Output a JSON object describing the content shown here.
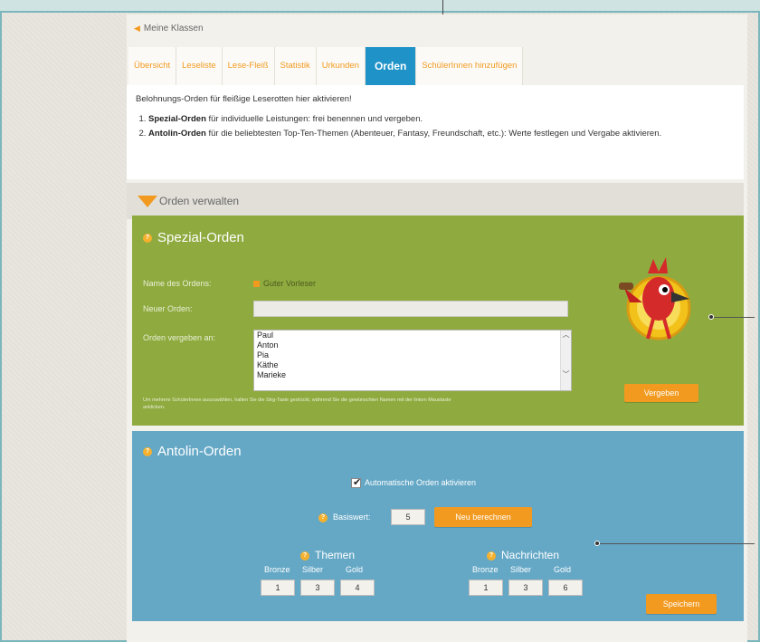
{
  "nav": {
    "back_label": "Meine Klassen"
  },
  "tabs": [
    {
      "label": "Übersicht"
    },
    {
      "label": "Leseliste"
    },
    {
      "label": "Lese-Fleiß"
    },
    {
      "label": "Statistik"
    },
    {
      "label": "Urkunden"
    },
    {
      "label": "Orden",
      "active": true
    },
    {
      "label": "SchülerInnen hinzufügen"
    }
  ],
  "intro": {
    "line1": "Belohnungs-Orden für fleißige Leserotten hier aktivieren!",
    "item1_bold": "Spezial-Orden",
    "item1_text": " für individuelle Leistungen: frei benennen und vergeben.",
    "item2_bold": "Antolin-Orden",
    "item2_text": " für die beliebtesten Top-Ten-Themen (Abenteuer, Fantasy, Freundschaft, etc.): Werte festlegen und Vergabe aktivieren."
  },
  "section": {
    "title": "Orden verwalten"
  },
  "spezial": {
    "title": "Spezial-Orden",
    "name_label": "Name des Ordens:",
    "name_value": "Guter Vorleser",
    "new_label": "Neuer Orden:",
    "new_value": "",
    "assign_label": "Orden vergeben an:",
    "students": [
      "Paul",
      "Anton",
      "Pia",
      "Käthe",
      "Marieke"
    ],
    "hint": "Um mehrere SchülerInnen auszuwählen, halten Sie die Strg-Taste gedrückt, während Sie die gewünschten Namen mit der linken Maustaste anklicken.",
    "button": "Vergeben"
  },
  "antolin": {
    "title": "Antolin-Orden",
    "auto_label": "Automatische Orden aktivieren",
    "auto_checked": true,
    "basis_label": "Basiswert:",
    "basis_value": "5",
    "recalc_button": "Neu berechnen",
    "themen": {
      "title": "Themen",
      "labels": [
        "Bronze",
        "Silber",
        "Gold"
      ],
      "values": [
        "1",
        "3",
        "4"
      ]
    },
    "nachrichten": {
      "title": "Nachrichten",
      "labels": [
        "Bronze",
        "Silber",
        "Gold"
      ],
      "values": [
        "1",
        "3",
        "6"
      ]
    },
    "save_button": "Speichern"
  },
  "colors": {
    "accent": "#f29a1f",
    "active_tab": "#1f93c8",
    "green_panel": "#8faa3f",
    "blue_panel": "#65a8c6"
  }
}
